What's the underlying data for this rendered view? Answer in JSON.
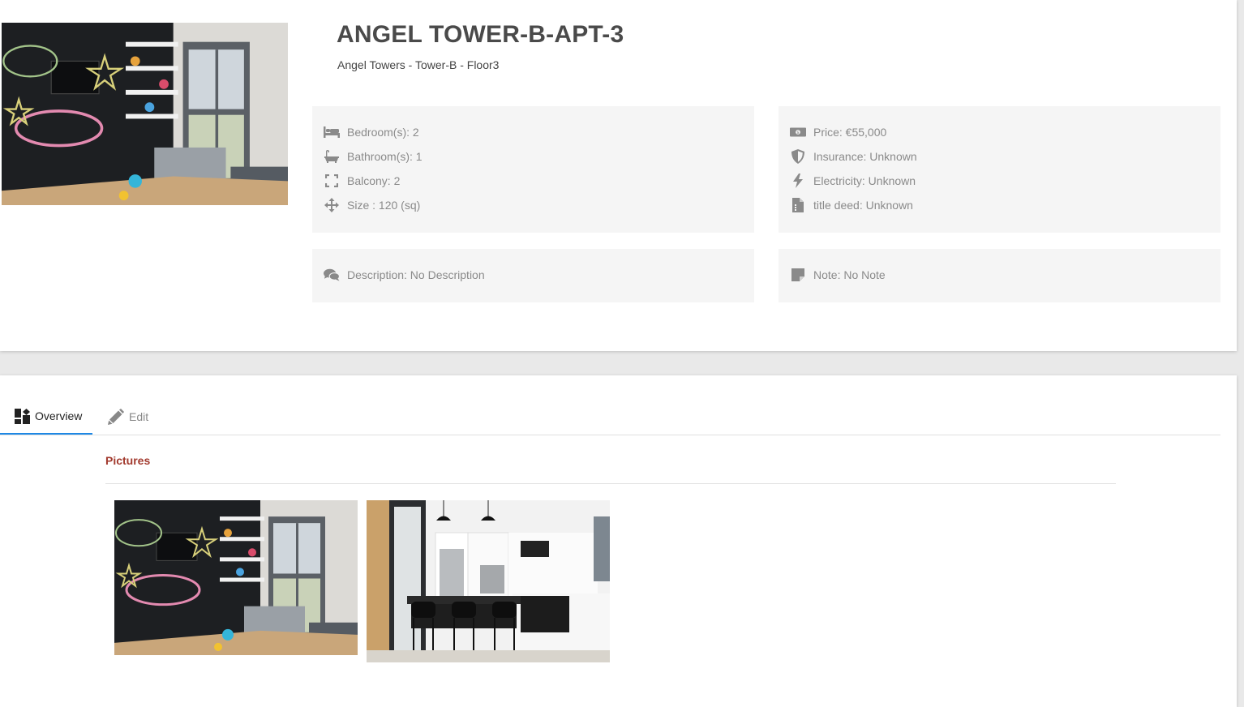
{
  "property": {
    "title": "ANGEL TOWER-B-APT-3",
    "subtitle": "Angel Towers - Tower-B - Floor3",
    "main_photo": "kids-room-chalkboard-photo"
  },
  "details": [
    {
      "icon": "bed-icon",
      "text": "Bedroom(s): 2"
    },
    {
      "icon": "bathtub-icon",
      "text": "Bathroom(s): 1"
    },
    {
      "icon": "expand-icon",
      "text": "Balcony: 2"
    },
    {
      "icon": "move-arrows-icon",
      "text": "Size : 120 (sq)"
    }
  ],
  "finance": [
    {
      "icon": "money-bill-icon",
      "text": "Price: €55,000"
    },
    {
      "icon": "shield-icon",
      "text": "Insurance: Unknown"
    },
    {
      "icon": "bolt-icon",
      "text": "Electricity: Unknown"
    },
    {
      "icon": "file-icon",
      "text": "title deed: Unknown"
    }
  ],
  "description": {
    "icon": "comments-icon",
    "text": "Description: No Description"
  },
  "note": {
    "icon": "sticky-note-icon",
    "text": "Note: No Note"
  },
  "tabs": [
    {
      "label": "Overview",
      "icon": "dashboard-icon",
      "active": true
    },
    {
      "label": "Edit",
      "icon": "pencil-icon",
      "active": false
    }
  ],
  "pictures": {
    "heading": "Pictures",
    "items": [
      "kids-room-chalkboard-photo",
      "modern-kitchen-photo"
    ]
  },
  "colors": {
    "accent_tab": "#1e88e5",
    "section_heading": "#a23a2e",
    "panel_bg": "#f5f5f5"
  }
}
